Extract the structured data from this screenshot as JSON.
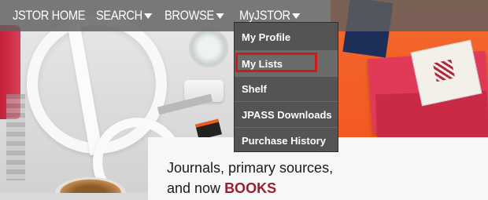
{
  "nav": {
    "home_label": "JSTOR HOME",
    "search_label": "SEARCH",
    "browse_label": "BROWSE",
    "myjstor_label": "MyJSTOR"
  },
  "myjstor_menu": {
    "items": [
      {
        "label": "My Profile"
      },
      {
        "label": "My Lists",
        "highlighted": true
      },
      {
        "label": "Shelf"
      },
      {
        "label": "JPASS Downloads"
      },
      {
        "label": "Purchase History"
      }
    ]
  },
  "hero": {
    "tagline_line1": "Journals, primary sources,",
    "tagline_line2_prefix": "and now ",
    "tagline_line2_accent": "BOOKS"
  },
  "colors": {
    "nav_bg": "#5f5f5f",
    "menu_bg": "#545454",
    "focus_outline": "#d01a1a",
    "books_accent": "#9c1e2c",
    "hero_orange": "#f35a22"
  }
}
